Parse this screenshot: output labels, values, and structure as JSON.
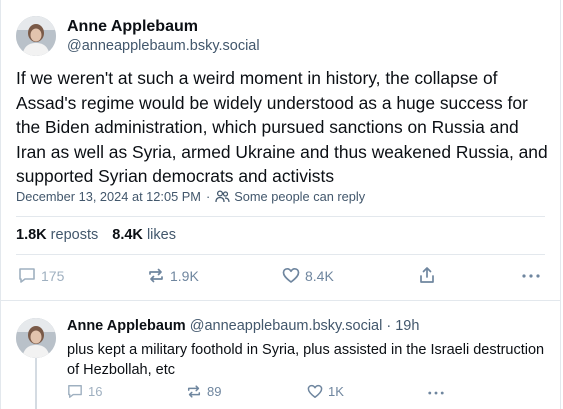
{
  "main_post": {
    "author_name": "Anne Applebaum",
    "author_handle": "@anneapplebaum.bsky.social",
    "text": "If we weren't at such a weird moment in history, the collapse of Assad's regime would be widely understood as a huge success for the Biden administration, which pursued sanctions on Russia and Iran as well as Syria, armed Ukraine and thus weakened Russia, and supported Syrian democrats and activists",
    "timestamp": "December 13, 2024 at 12:05 PM",
    "separator": "·",
    "reply_setting": "Some people can reply",
    "reposts_count": "1.8K",
    "reposts_label": "reposts",
    "likes_count": "8.4K",
    "likes_label": "likes",
    "actions": {
      "reply_count": "175",
      "repost_count": "1.9K",
      "like_count": "8.4K"
    }
  },
  "reply_post": {
    "author_name": "Anne Applebaum",
    "author_handle": "@anneapplebaum.bsky.social",
    "separator": "·",
    "age": "19h",
    "text": "plus kept a military foothold in Syria, plus assisted in the Israeli destruction of Hezbollah, etc",
    "actions": {
      "reply_count": "16",
      "repost_count": "89",
      "like_count": "1K"
    }
  },
  "colors": {
    "accent": "#1083fe",
    "muted": "#42576c",
    "icon": "#6f869f",
    "border": "#e3e8ed"
  }
}
